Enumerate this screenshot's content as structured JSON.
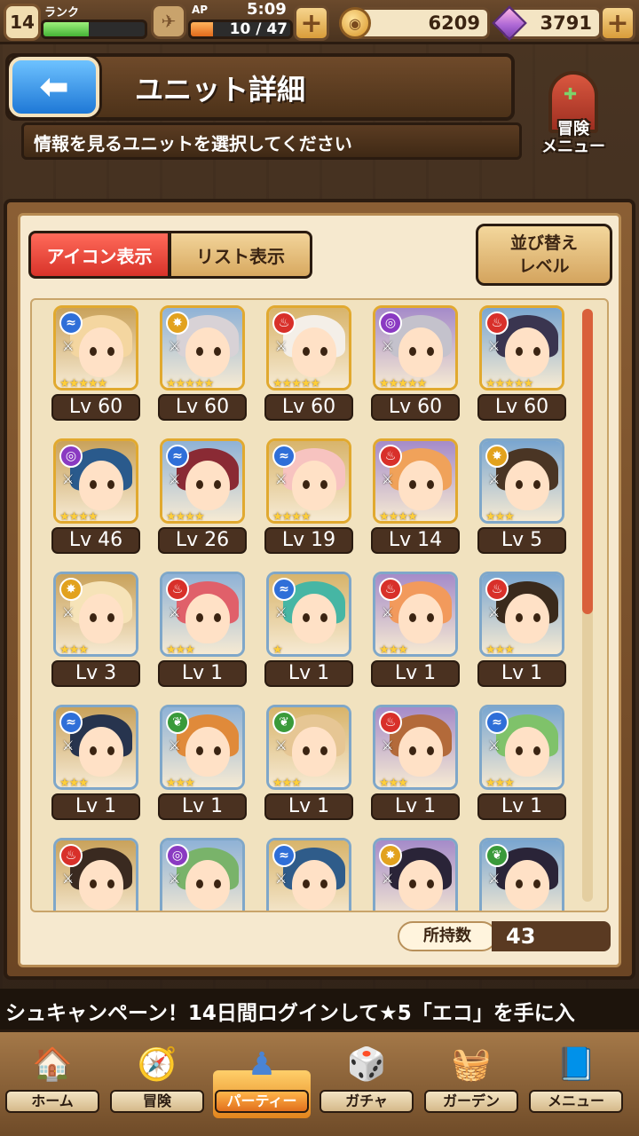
{
  "status": {
    "rank_level": "14",
    "rank_label": "ランク",
    "rank_progress": 0.45,
    "ap_label": "AP",
    "time": "5:09",
    "ap_value": "10 / 47",
    "ap_progress": 0.22,
    "coins": "6209",
    "gems": "3791"
  },
  "header": {
    "title": "ユニット詳細",
    "instruction": "情報を見るユニットを選択してください",
    "adventure_menu_label": "冒険\nメニュー"
  },
  "panel": {
    "tab_icon": "アイコン表示",
    "tab_list": "リスト表示",
    "sort_line1": "並び替え",
    "sort_line2": "レベル",
    "owned_label": "所持数",
    "owned_count": "43"
  },
  "units": [
    {
      "level": "Lv 60",
      "element": "water",
      "stars": 5,
      "hair": "#f4d6a0"
    },
    {
      "level": "Lv 60",
      "element": "light",
      "stars": 5,
      "hair": "#d8d2d6"
    },
    {
      "level": "Lv 60",
      "element": "fire",
      "stars": 5,
      "hair": "#f4efe8"
    },
    {
      "level": "Lv 60",
      "element": "dark",
      "stars": 5,
      "hair": "#c4c2cc"
    },
    {
      "level": "Lv 60",
      "element": "fire",
      "stars": 5,
      "hair": "#3a3550"
    },
    {
      "level": "Lv 46",
      "element": "dark",
      "stars": 4,
      "hair": "#2a5a8c"
    },
    {
      "level": "Lv 26",
      "element": "water",
      "stars": 4,
      "hair": "#8a2a34"
    },
    {
      "level": "Lv 19",
      "element": "water",
      "stars": 4,
      "hair": "#f7c3c0"
    },
    {
      "level": "Lv 14",
      "element": "fire",
      "stars": 4,
      "hair": "#f0a25a"
    },
    {
      "level": "Lv 5",
      "element": "light",
      "stars": 3,
      "hair": "#4a3524"
    },
    {
      "level": "Lv 3",
      "element": "light",
      "stars": 3,
      "hair": "#f6e3b8"
    },
    {
      "level": "Lv 1",
      "element": "fire",
      "stars": 3,
      "hair": "#e0606a"
    },
    {
      "level": "Lv 1",
      "element": "water",
      "stars": 1,
      "hair": "#46b6a4"
    },
    {
      "level": "Lv 1",
      "element": "fire",
      "stars": 3,
      "hair": "#f29a5c"
    },
    {
      "level": "Lv 1",
      "element": "fire",
      "stars": 3,
      "hair": "#3a2a1c"
    },
    {
      "level": "Lv 1",
      "element": "water",
      "stars": 3,
      "hair": "#27344e"
    },
    {
      "level": "Lv 1",
      "element": "wind",
      "stars": 3,
      "hair": "#e08a3a"
    },
    {
      "level": "Lv 1",
      "element": "wind",
      "stars": 3,
      "hair": "#e6c694"
    },
    {
      "level": "Lv 1",
      "element": "fire",
      "stars": 3,
      "hair": "#b36a3a"
    },
    {
      "level": "Lv 1",
      "element": "water",
      "stars": 3,
      "hair": "#7fc26a"
    },
    {
      "level": "",
      "element": "fire",
      "stars": 0,
      "hair": "#3a2a20"
    },
    {
      "level": "",
      "element": "dark",
      "stars": 0,
      "hair": "#79b36a"
    },
    {
      "level": "",
      "element": "water",
      "stars": 0,
      "hair": "#2f5c8a"
    },
    {
      "level": "",
      "element": "light",
      "stars": 0,
      "hair": "#2a2438"
    },
    {
      "level": "",
      "element": "wind",
      "stars": 0,
      "hair": "#2a2438"
    }
  ],
  "element_colors": {
    "water": "#2f6fd8",
    "light": "#e2a21e",
    "fire": "#d8302a",
    "dark": "#8a3ac2",
    "wind": "#3a9a3a"
  },
  "ticker": "シュキャンペーン！14日間ログインして★5「エコ」を手に入",
  "nav": [
    {
      "label": "ホーム",
      "icon": "home-icon",
      "glyph": "🏠",
      "active": false
    },
    {
      "label": "冒険",
      "icon": "adventure-icon",
      "glyph": "🧭",
      "active": false
    },
    {
      "label": "パーティー",
      "icon": "party-icon",
      "glyph": "♟",
      "active": true
    },
    {
      "label": "ガチャ",
      "icon": "gacha-icon",
      "glyph": "🎲",
      "active": false
    },
    {
      "label": "ガーデン",
      "icon": "garden-icon",
      "glyph": "🧺",
      "active": false
    },
    {
      "label": "メニュー",
      "icon": "menu-icon",
      "glyph": "📘",
      "active": false
    }
  ]
}
